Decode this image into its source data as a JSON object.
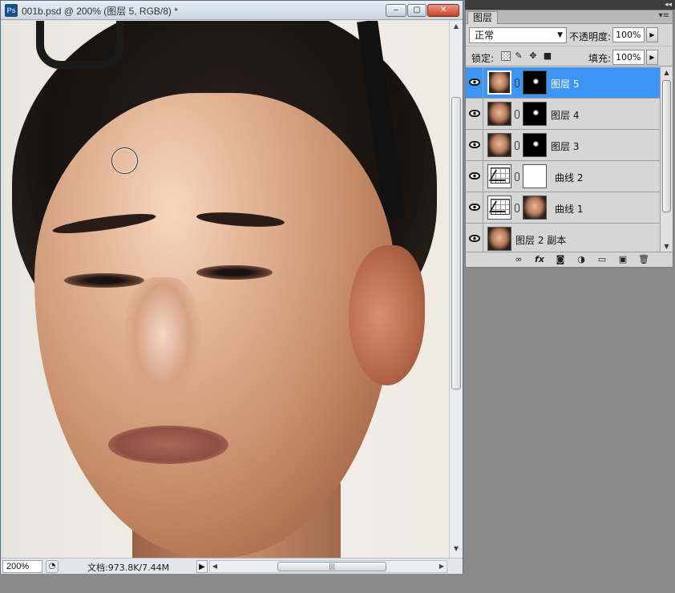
{
  "document": {
    "app_icon": "Ps",
    "title": "001b.psd @ 200% (图层 5, RGB/8) *",
    "window_buttons": {
      "minimize": "‒",
      "maximize": "▢",
      "close": "✕"
    }
  },
  "status": {
    "zoom": "200%",
    "doc_info": "文档:973.8K/7.44M",
    "arrow": "▶",
    "scroll_grip": "|||"
  },
  "panel": {
    "collapse_label": "◂◂",
    "tab": "图层",
    "menu_icon": "▾≡",
    "blend_mode": "正常",
    "opacity_label": "不透明度:",
    "opacity_value": "100%",
    "lock_label": "锁定:",
    "fill_label": "填充:",
    "fill_value": "100%",
    "layers": [
      {
        "name": "图层 5",
        "selected": true,
        "thumb": "photo",
        "mask": "mask-dark"
      },
      {
        "name": "图层 4",
        "selected": false,
        "thumb": "photo",
        "mask": "mask-dark"
      },
      {
        "name": "图层 3",
        "selected": false,
        "thumb": "photo",
        "mask": "mask-dark"
      },
      {
        "name": "曲线 2",
        "selected": false,
        "thumb": "curves",
        "mask": "mask-white"
      },
      {
        "name": "曲线 1",
        "selected": false,
        "thumb": "curves",
        "mask": "photo"
      },
      {
        "name": "图层 2 副本",
        "selected": false,
        "thumb": "photo",
        "mask": null
      }
    ],
    "bottom_icons": [
      "link-icon",
      "fx-icon",
      "mask-icon",
      "adjustment-icon",
      "folder-icon",
      "new-layer-icon",
      "trash-icon"
    ]
  },
  "icons": {
    "eye": "eye-icon",
    "brush_cursor": "brush-cursor-icon"
  },
  "colors": {
    "selection": "#3d96f5",
    "workspace": "#8a8a8a"
  }
}
